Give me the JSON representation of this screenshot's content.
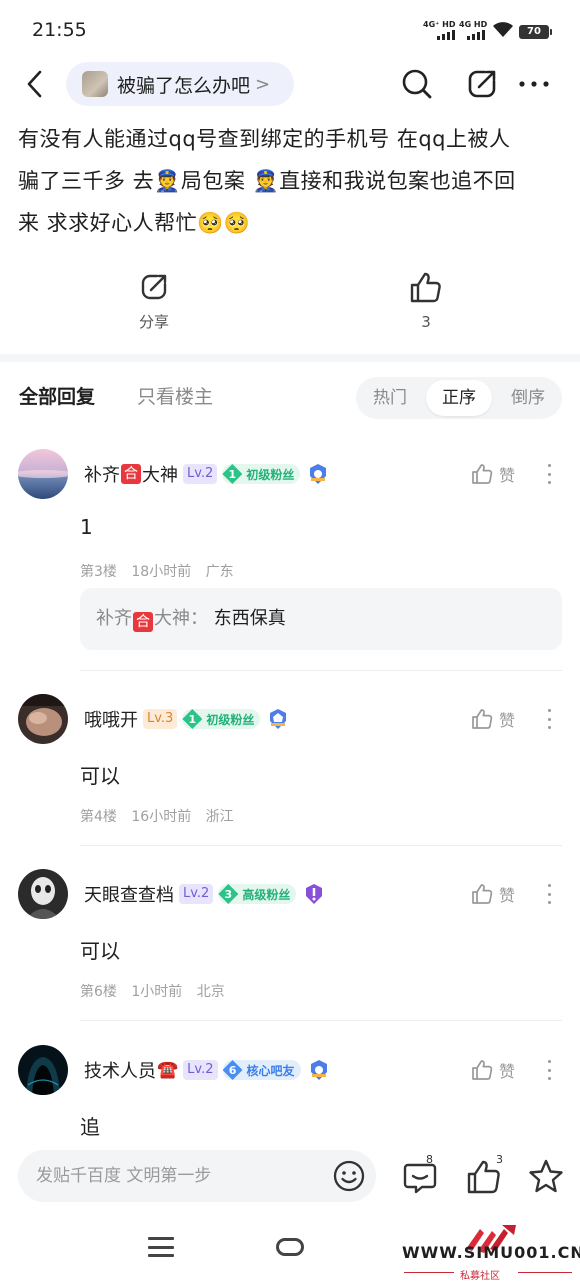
{
  "status_bar": {
    "time": "21:55",
    "network_1": "4G⁺ HD",
    "network_2": "4G HD",
    "battery": "70"
  },
  "nav": {
    "forum_name": "被骗了怎么办吧",
    "chevron": ">",
    "icons": [
      "back-icon",
      "search-icon",
      "share-icon",
      "more-icon"
    ]
  },
  "post": {
    "lines": [
      "有没有人能通过qq号查到绑定的手机号 在qq上被人",
      "骗了三千多 去👮局包案 👮直接和我说包案也追不回",
      "来 求求好心人帮忙🥺🥺"
    ],
    "share_label": "分享",
    "like_count": "3"
  },
  "reply_filter": {
    "tab_all": "全部回复",
    "tab_op_only": "只看楼主",
    "sort_options": [
      "热门",
      "正序",
      "倒序"
    ],
    "sort_active": "正序"
  },
  "comments": [
    {
      "name_pre": "补齐",
      "name_badge": "合",
      "name_post": "大神",
      "level": "Lv.2",
      "fan_num": "1",
      "fan_label": "初级粉丝",
      "like_label": "赞",
      "text": "1",
      "floor": "第3楼",
      "time": "18小时前",
      "location": "广东",
      "quote_name_pre": "补齐",
      "quote_name_badge": "合",
      "quote_name_post": "大神：",
      "quote_text": "东西保真"
    },
    {
      "name": "哦哦开",
      "level": "Lv.3",
      "fan_num": "1",
      "fan_label": "初级粉丝",
      "like_label": "赞",
      "text": "可以",
      "floor": "第4楼",
      "time": "16小时前",
      "location": "浙江"
    },
    {
      "name": "天眼查查档",
      "level": "Lv.2",
      "fan_num": "3",
      "fan_label": "高级粉丝",
      "like_label": "赞",
      "text": "可以",
      "floor": "第6楼",
      "time": "1小时前",
      "location": "北京"
    },
    {
      "name": "技术人员",
      "name_emoji": "☎️",
      "level": "Lv.2",
      "fan_num": "6",
      "fan_label": "核心吧友",
      "like_label": "赞",
      "text": "追"
    }
  ],
  "bottom_bar": {
    "input_placeholder": "发贴千百度 文明第一步",
    "comment_count": "8",
    "like_count": "3"
  },
  "watermark": {
    "site": "WWW.SIMU001.CN",
    "subtitle": "私募社区"
  },
  "colors": {
    "accent_blue": "#3d7fe6",
    "level_purple": "#6e5fd8",
    "fan_green": "#23b178",
    "badge_red": "#e8383d",
    "watermark_red": "#c92a3a"
  }
}
